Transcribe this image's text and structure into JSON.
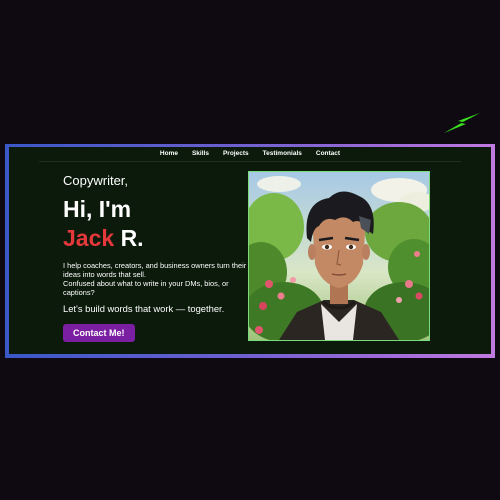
{
  "nav": {
    "items": [
      "Home",
      "Skills",
      "Projects",
      "Testimonials",
      "Contact"
    ]
  },
  "hero": {
    "kicker": "Copywriter,",
    "greeting": "Hi, I'm",
    "first_name": "Jack",
    "last_name": "R.",
    "desc_line1": "I help coaches, creators, and business owners turn their ideas into words that sell.",
    "desc_line2": "Confused about what to write in your DMs, bios, or captions?",
    "tagline": "Let's build words that work — together.",
    "cta_label": "Contact Me!"
  },
  "colors": {
    "accent_name": "#e5383b",
    "cta": "#7b1fa2",
    "bolt": "#39e01f",
    "frame_start": "#3a58c8",
    "frame_end": "#c07ae0",
    "portrait_border": "#7bdc7b"
  },
  "icons": {
    "decoration": "lightning-bolt-icon",
    "portrait": "anime-portrait-illustration"
  }
}
